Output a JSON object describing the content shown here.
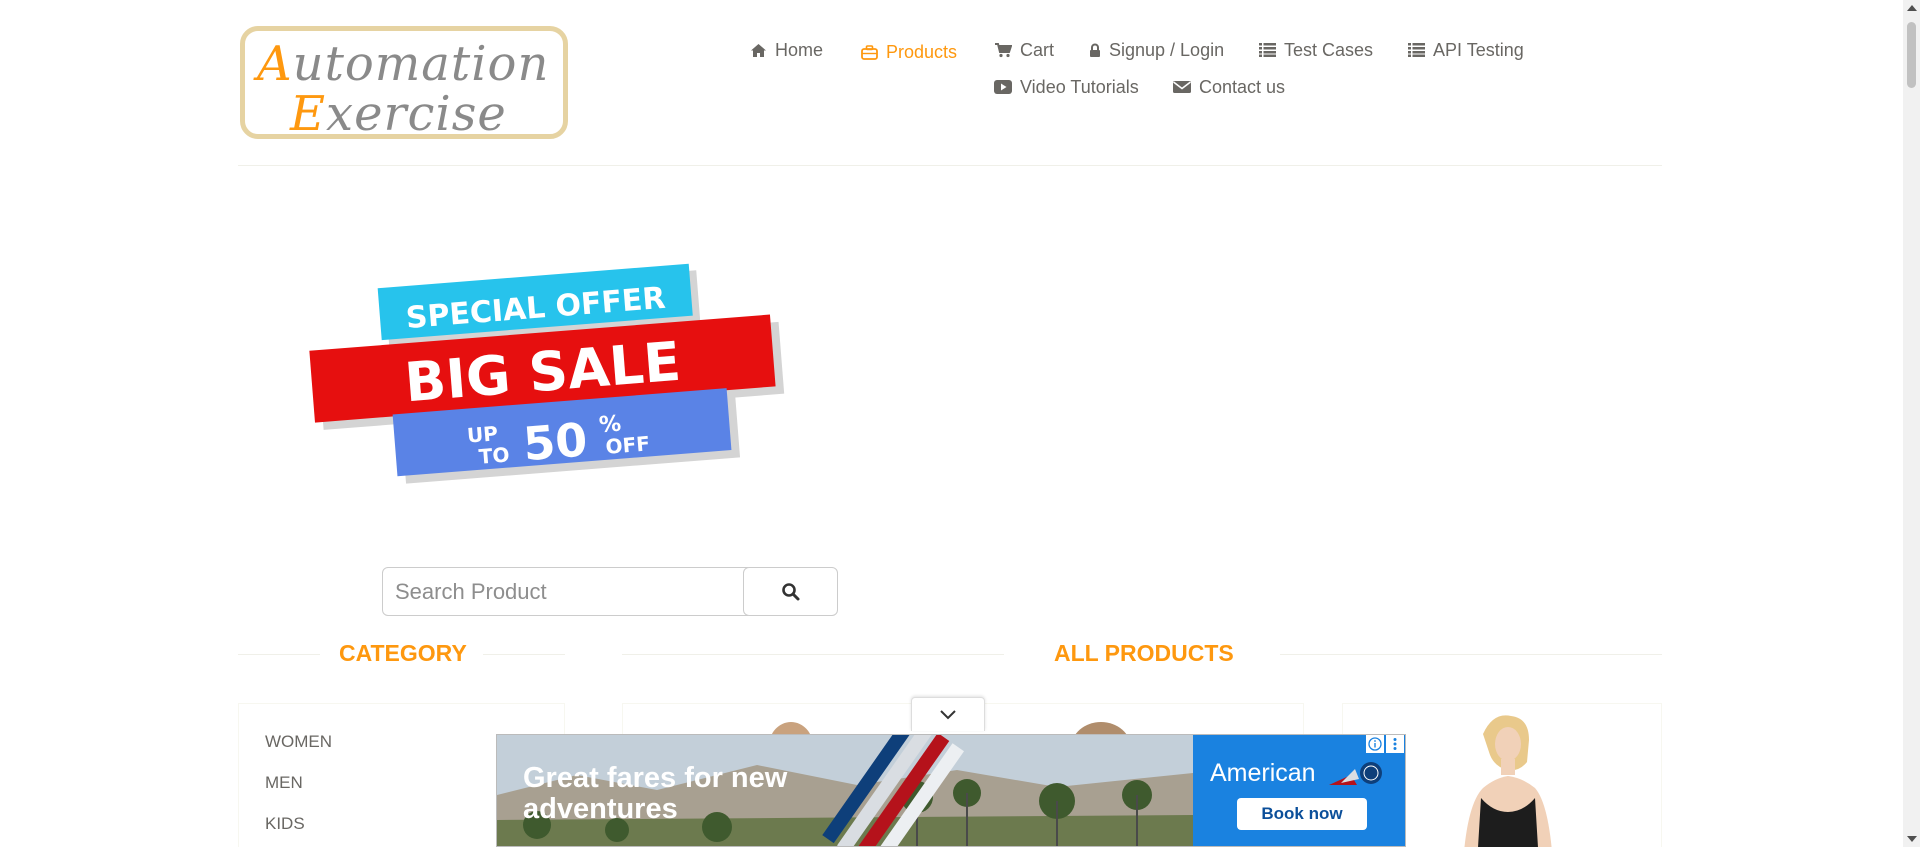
{
  "logo": {
    "line1_cap": "A",
    "line1_rest": "utomation",
    "line2_cap": "E",
    "line2_rest": "xercise"
  },
  "nav": [
    {
      "label": "Home",
      "icon": "home-icon"
    },
    {
      "label": "Products",
      "icon": "briefcase-icon",
      "active": true
    },
    {
      "label": "Cart",
      "icon": "cart-icon"
    },
    {
      "label": "Signup / Login",
      "icon": "lock-icon"
    },
    {
      "label": "Test Cases",
      "icon": "list-icon"
    },
    {
      "label": "API Testing",
      "icon": "list-icon"
    },
    {
      "label": "Video Tutorials",
      "icon": "youtube-play-icon"
    },
    {
      "label": "Contact us",
      "icon": "envelope-icon"
    }
  ],
  "sale_banner": {
    "top": "SPECIAL OFFER",
    "middle": "BIG SALE",
    "up": "UP",
    "to": "TO",
    "percent": "50",
    "percent_sign": "%",
    "off": "OFF"
  },
  "search": {
    "placeholder": "Search Product",
    "value": ""
  },
  "category": {
    "title": "CATEGORY",
    "items": [
      "WOMEN",
      "MEN",
      "KIDS"
    ]
  },
  "products": {
    "title": "ALL PRODUCTS"
  },
  "ad": {
    "headline": "Great fares for new adventures",
    "brand": "American",
    "cta": "Book now"
  },
  "colors": {
    "accent": "#FE980F",
    "text": "#696763",
    "ad_blue": "#1A82E0"
  }
}
